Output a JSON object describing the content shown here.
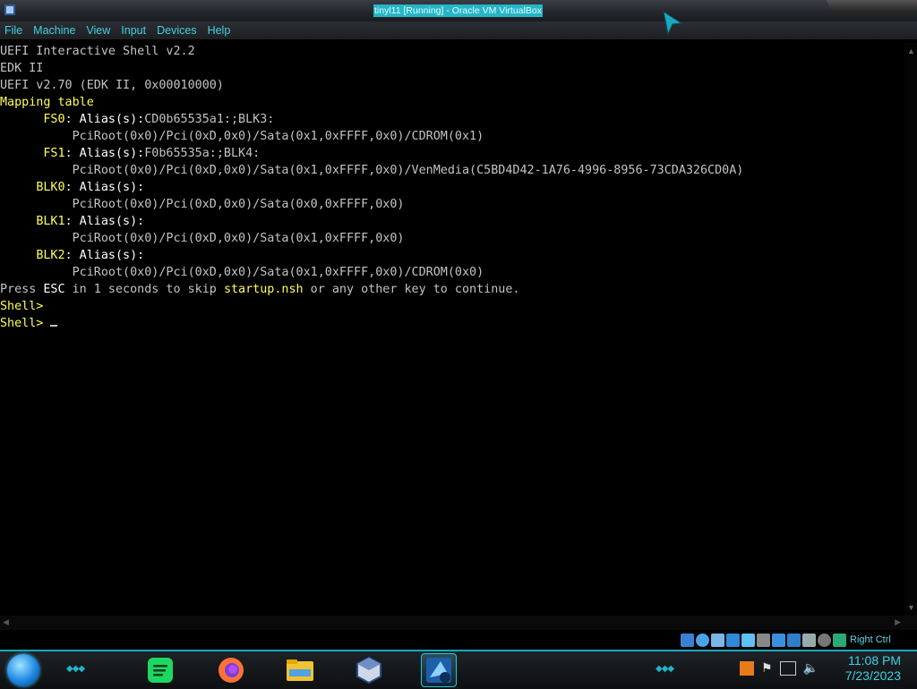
{
  "window": {
    "title": "tinyl11 [Running] - Oracle VM VirtualBox",
    "menu": [
      "File",
      "Machine",
      "View",
      "Input",
      "Devices",
      "Help"
    ]
  },
  "console": {
    "lines": [
      {
        "text": "UEFI Interactive Shell v2.2"
      },
      {
        "text": "EDK II"
      },
      {
        "text": "UEFI v2.70 (EDK II, 0x00010000)"
      },
      {
        "text": "Mapping table"
      },
      {
        "text": "      FS0: Alias(s):CD0b65535a1:;BLK3:"
      },
      {
        "text": "          PciRoot(0x0)/Pci(0xD,0x0)/Sata(0x1,0xFFFF,0x0)/CDROM(0x1)"
      },
      {
        "text": "      FS1: Alias(s):F0b65535a:;BLK4:"
      },
      {
        "text": "          PciRoot(0x0)/Pci(0xD,0x0)/Sata(0x1,0xFFFF,0x0)/VenMedia(C5BD4D42-1A76-4996-8956-73CDA326CD0A)"
      },
      {
        "text": "     BLK0: Alias(s):"
      },
      {
        "text": "          PciRoot(0x0)/Pci(0xD,0x0)/Sata(0x0,0xFFFF,0x0)"
      },
      {
        "text": "     BLK1: Alias(s):"
      },
      {
        "text": "          PciRoot(0x0)/Pci(0xD,0x0)/Sata(0x1,0xFFFF,0x0)"
      },
      {
        "text": "     BLK2: Alias(s):"
      },
      {
        "text": "          PciRoot(0x0)/Pci(0xD,0x0)/Sata(0x1,0xFFFF,0x0)/CDROM(0x0)"
      },
      {
        "text": "Press ESC in 1 seconds to skip startup.nsh or any other key to continue."
      },
      {
        "text": "Shell>"
      },
      {
        "text": "Shell> "
      }
    ]
  },
  "statusbar": {
    "host_key": "Right Ctrl",
    "icons": [
      "hard-disk-icon",
      "optical-drive-icon",
      "audio-icon",
      "network-icon",
      "usb-icon",
      "shared-folder-icon",
      "display-icon",
      "recording-icon",
      "cpu-icon",
      "mouse-integration-icon",
      "keyboard-icon"
    ]
  },
  "taskbar": {
    "apps": [
      "spotify-icon",
      "firefox-icon",
      "file-explorer-icon",
      "virtualbox-icon",
      "virtualbox-vm-icon"
    ],
    "tray": [
      "java-icon",
      "flag-icon",
      "network-tray-icon",
      "volume-icon"
    ],
    "time": "11:08 PM",
    "date": "7/23/2023"
  },
  "colors": {
    "accent": "#27b5c6",
    "console_gray": "#c3c3c3",
    "console_yellow": "#ffff55",
    "console_white": "#ffffff"
  }
}
